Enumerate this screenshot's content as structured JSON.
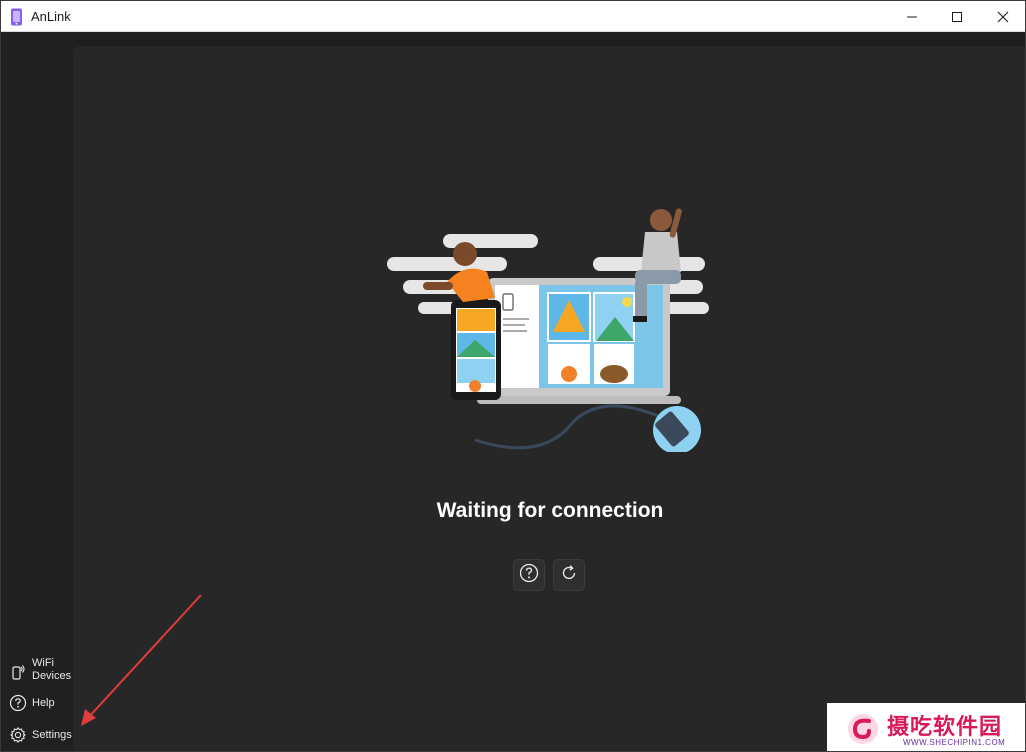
{
  "window": {
    "title": "AnLink",
    "controls": [
      "minimize-icon",
      "maximize-icon",
      "close-icon"
    ]
  },
  "nav": {
    "items": [
      {
        "label_line1": "WiFi",
        "label_line2": "Devices",
        "icon": "wifi-device-icon"
      },
      {
        "label": "Help",
        "icon": "help-icon"
      },
      {
        "label": "Settings",
        "icon": "gear-icon"
      }
    ]
  },
  "main": {
    "status_text": "Waiting for connection",
    "buttons": [
      {
        "icon": "help-icon"
      },
      {
        "icon": "refresh-icon"
      }
    ]
  },
  "watermark": {
    "title": "摄吃软件园",
    "subtitle": "WWW.SHECHIPIN1.COM"
  },
  "colors": {
    "background": "#202020",
    "panel": "#272727",
    "annotation_arrow": "#e03c3c",
    "watermark_accent": "#d9195c"
  }
}
